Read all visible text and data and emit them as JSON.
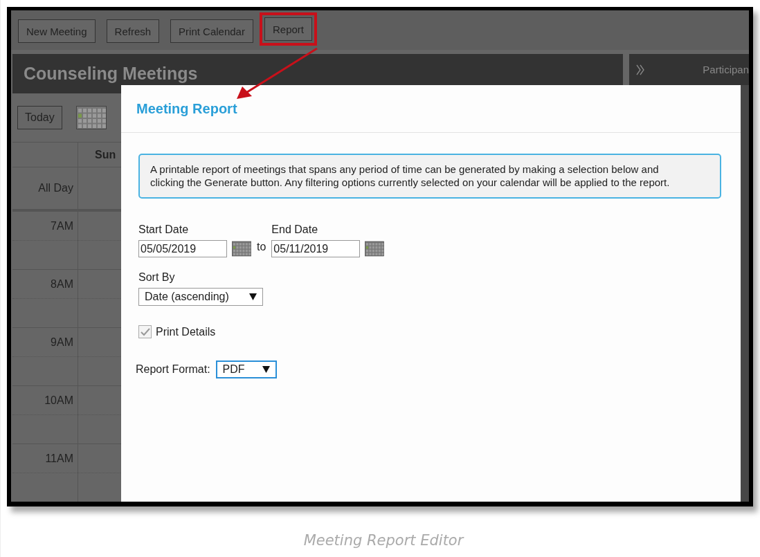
{
  "toolbar": {
    "buttons": [
      {
        "label": "New Meeting",
        "highlighted": false
      },
      {
        "label": "Refresh",
        "highlighted": false
      },
      {
        "label": "Print Calendar",
        "highlighted": false
      },
      {
        "label": "Report",
        "highlighted": true
      }
    ]
  },
  "header": {
    "title": "Counseling Meetings"
  },
  "side_panel": {
    "title": "Participan"
  },
  "calendar": {
    "today_button": "Today",
    "columns": [
      "Sun"
    ],
    "rows": [
      {
        "label": "All Day",
        "kind": "all-day"
      },
      {
        "label": "7AM",
        "kind": "hour"
      },
      {
        "label": "8AM",
        "kind": "hour"
      },
      {
        "label": "9AM",
        "kind": "hour"
      },
      {
        "label": "10AM",
        "kind": "hour"
      },
      {
        "label": "11AM",
        "kind": "hour"
      },
      {
        "label": "",
        "kind": "hour"
      }
    ]
  },
  "dialog": {
    "title": "Meeting Report",
    "info": "A printable report of meetings that spans any period of time can be generated by making a selection below and clicking the Generate button. Any filtering options currently selected on your calendar will be applied to the report.",
    "start_date": {
      "label": "Start Date",
      "value": "05/05/2019"
    },
    "range_separator": "to",
    "end_date": {
      "label": "End Date",
      "value": "05/11/2019"
    },
    "sort_by": {
      "label": "Sort By",
      "value": "Date (ascending)",
      "focused": false
    },
    "print_details": {
      "label": "Print Details",
      "checked": true
    },
    "report_format": {
      "label": "Report Format:",
      "value": "PDF",
      "focused": true
    }
  },
  "caption": "Meeting Report Editor"
}
